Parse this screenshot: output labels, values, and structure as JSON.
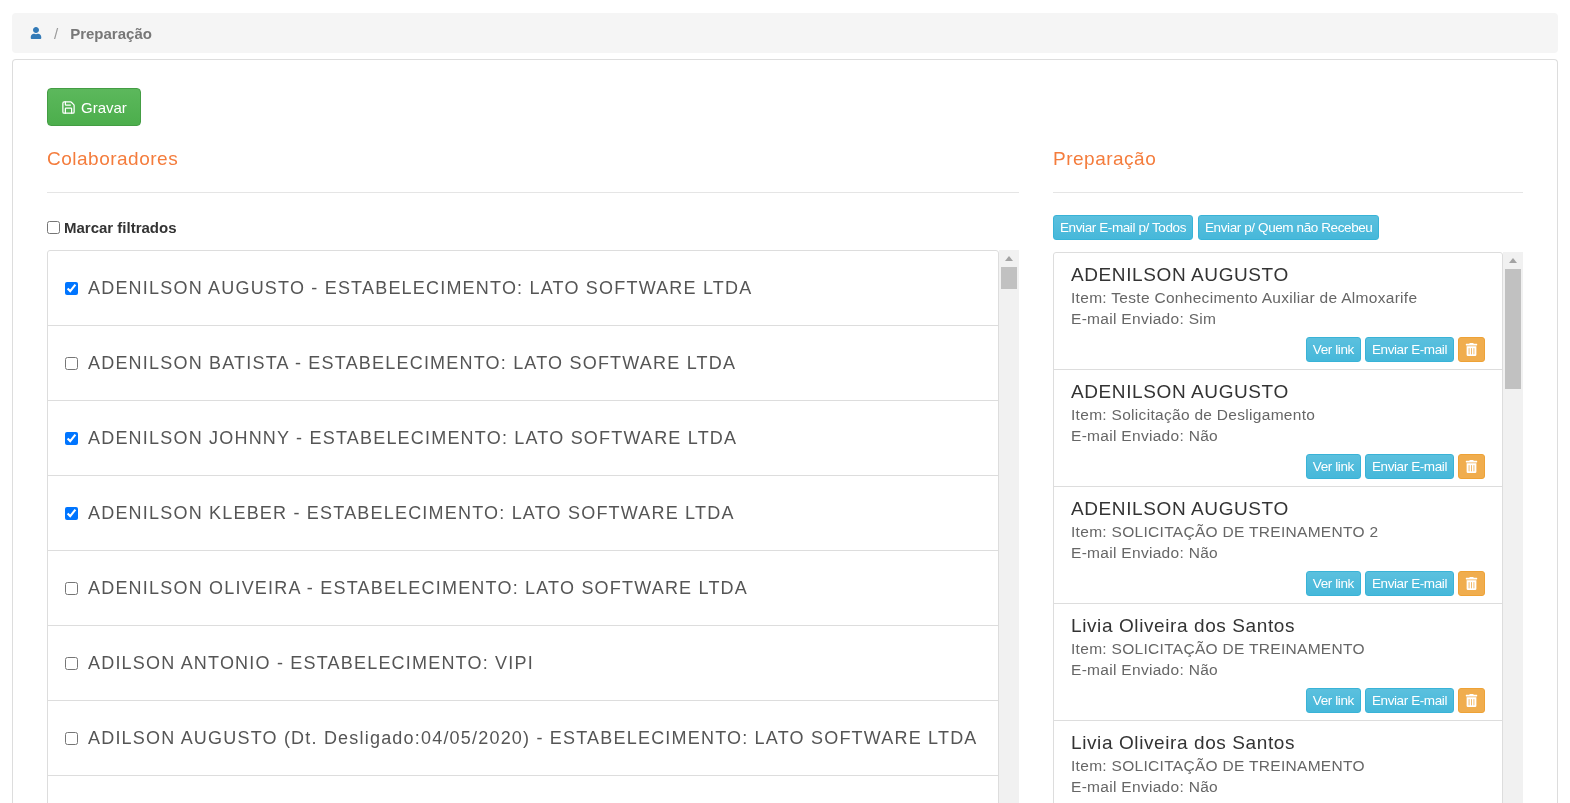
{
  "breadcrumb": {
    "separator": "/",
    "current": "Preparação"
  },
  "save_button": {
    "label": "Gravar"
  },
  "colaboradores": {
    "title": "Colaboradores",
    "mark_filtered": {
      "label": "Marcar filtrados",
      "checked": false
    },
    "rows": [
      {
        "label": "ADENILSON AUGUSTO - ESTABELECIMENTO: LATO SOFTWARE LTDA",
        "checked": true
      },
      {
        "label": "ADENILSON BATISTA - ESTABELECIMENTO: LATO SOFTWARE LTDA",
        "checked": false
      },
      {
        "label": "ADENILSON JOHNNY - ESTABELECIMENTO: LATO SOFTWARE LTDA",
        "checked": true
      },
      {
        "label": "ADENILSON KLEBER - ESTABELECIMENTO: LATO SOFTWARE LTDA",
        "checked": true
      },
      {
        "label": "ADENILSON OLIVEIRA - ESTABELECIMENTO: LATO SOFTWARE LTDA",
        "checked": false
      },
      {
        "label": "ADILSON ANTONIO - ESTABELECIMENTO: VIPI",
        "checked": false
      },
      {
        "label": "ADILSON AUGUSTO (Dt. Desligado:04/05/2020) - ESTABELECIMENTO: LATO SOFTWARE LTDA",
        "checked": false
      }
    ]
  },
  "preparacao": {
    "title": "Preparação",
    "actions": [
      "Enviar E-mail p/ Todos",
      "Enviar p/ Quem não Recebeu"
    ],
    "items": [
      {
        "name": "ADENILSON AUGUSTO",
        "item": "Item: Teste Conhecimento Auxiliar de Almoxarife",
        "sent": "E-mail Enviado: Sim",
        "buttons": [
          "Ver link",
          "Enviar E-mail"
        ]
      },
      {
        "name": "ADENILSON AUGUSTO",
        "item": "Item: Solicitação de Desligamento",
        "sent": "E-mail Enviado: Não",
        "buttons": [
          "Ver link",
          "Enviar E-mail"
        ]
      },
      {
        "name": "ADENILSON AUGUSTO",
        "item": "Item: SOLICITAÇÃO DE TREINAMENTO 2",
        "sent": "E-mail Enviado: Não",
        "buttons": [
          "Ver link",
          "Enviar E-mail"
        ]
      },
      {
        "name": "Livia Oliveira dos Santos",
        "item": "Item: SOLICITAÇÃO DE TREINAMENTO",
        "sent": "E-mail Enviado: Não",
        "buttons": [
          "Ver link",
          "Enviar E-mail"
        ]
      },
      {
        "name": "Livia Oliveira dos Santos",
        "item": "Item: SOLICITAÇÃO DE TREINAMENTO",
        "sent": "E-mail Enviado: Não"
      }
    ]
  }
}
